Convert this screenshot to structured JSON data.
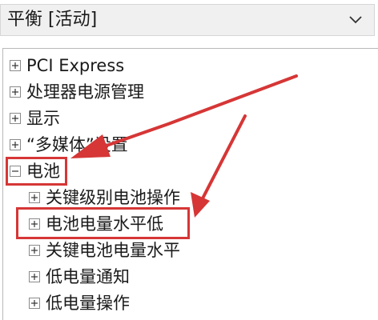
{
  "dropdown": {
    "value": "平衡 [活动]",
    "arrow_icon": "chevron-down-icon"
  },
  "tree": {
    "items": [
      {
        "label": "PCI Express",
        "state": "collapsed"
      },
      {
        "label": "处理器电源管理",
        "state": "collapsed"
      },
      {
        "label": "显示",
        "state": "collapsed"
      },
      {
        "label": "“多媒体”设置",
        "state": "collapsed"
      },
      {
        "label": "电池",
        "state": "expanded",
        "children": [
          {
            "label": "关键级别电池操作",
            "state": "collapsed"
          },
          {
            "label": "电池电量水平低",
            "state": "collapsed"
          },
          {
            "label": "关键电池电量水平",
            "state": "collapsed"
          },
          {
            "label": "低电量通知",
            "state": "collapsed"
          },
          {
            "label": "低电量操作",
            "state": "collapsed"
          }
        ]
      }
    ]
  },
  "annotations": {
    "highlight_color": "#d63636",
    "highlighted_items": [
      "电池",
      "电池电量水平低"
    ]
  }
}
